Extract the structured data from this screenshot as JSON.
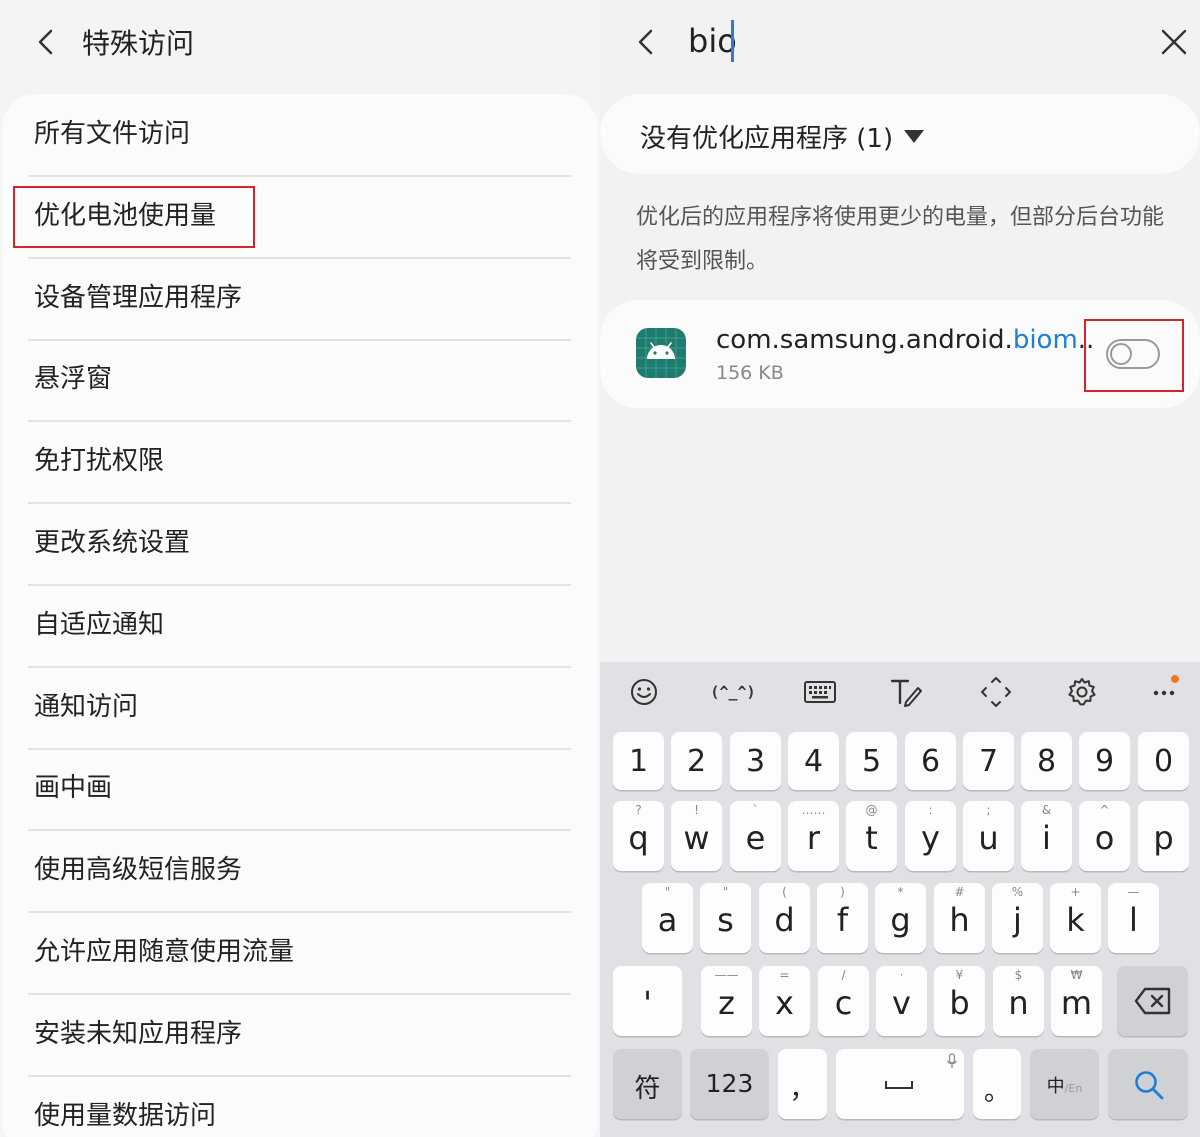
{
  "left_panel": {
    "title": "特殊访问",
    "back_icon": "chevron-left-icon",
    "items": [
      {
        "label": "所有文件访问"
      },
      {
        "label": "优化电池使用量"
      },
      {
        "label": "设备管理应用程序"
      },
      {
        "label": "悬浮窗"
      },
      {
        "label": "免打扰权限"
      },
      {
        "label": "更改系统设置"
      },
      {
        "label": "自适应通知"
      },
      {
        "label": "通知访问"
      },
      {
        "label": "画中画"
      },
      {
        "label": "使用高级短信服务"
      },
      {
        "label": "允许应用随意使用流量"
      },
      {
        "label": "安装未知应用程序"
      },
      {
        "label": "使用量数据访问"
      }
    ],
    "highlighted_item": "优化电池使用量"
  },
  "right_panel": {
    "search_value": "bio",
    "close_icon": "close-icon",
    "filter_label": "没有优化应用程序 (1)",
    "description": "优化后的应用程序将使用更少的电量，但部分后台功能将受到限制。",
    "app": {
      "name_prefix": "com.samsung.android.",
      "name_match": "biom",
      "name_suffix": "..",
      "size": "156 KB",
      "toggle_on": false
    }
  },
  "keyboard": {
    "toolbar_icons": [
      "emoji-icon",
      "kaomoji-icon",
      "keyboard-icon",
      "handwriting-icon",
      "cursor-move-icon",
      "settings-icon",
      "more-icon"
    ],
    "kaomoji_label": "(^_^)",
    "row_numbers": [
      "1",
      "2",
      "3",
      "4",
      "5",
      "6",
      "7",
      "8",
      "9",
      "0"
    ],
    "row_q": [
      {
        "k": "q",
        "s": "?"
      },
      {
        "k": "w",
        "s": "!"
      },
      {
        "k": "e",
        "s": "`"
      },
      {
        "k": "r",
        "s": "……"
      },
      {
        "k": "t",
        "s": "@"
      },
      {
        "k": "y",
        "s": ":"
      },
      {
        "k": "u",
        "s": ";"
      },
      {
        "k": "i",
        "s": "&"
      },
      {
        "k": "o",
        "s": "^"
      },
      {
        "k": "p",
        "s": ""
      }
    ],
    "row_a": [
      {
        "k": "a",
        "s": "\""
      },
      {
        "k": "s",
        "s": "\""
      },
      {
        "k": "d",
        "s": "("
      },
      {
        "k": "f",
        "s": ")"
      },
      {
        "k": "g",
        "s": "*"
      },
      {
        "k": "h",
        "s": "#"
      },
      {
        "k": "j",
        "s": "%"
      },
      {
        "k": "k",
        "s": "+"
      },
      {
        "k": "l",
        "s": "—"
      }
    ],
    "row_z": [
      {
        "k": "'",
        "s": ""
      },
      {
        "k": "z",
        "s": "——"
      },
      {
        "k": "x",
        "s": "="
      },
      {
        "k": "c",
        "s": "/"
      },
      {
        "k": "v",
        "s": "·"
      },
      {
        "k": "b",
        "s": "¥"
      },
      {
        "k": "n",
        "s": "$"
      },
      {
        "k": "m",
        "s": "₩"
      }
    ],
    "bottom": {
      "symbol": "符",
      "numbers": "123",
      "comma": "，",
      "period": "。",
      "lang_main": "中",
      "lang_sub": "/En"
    }
  }
}
